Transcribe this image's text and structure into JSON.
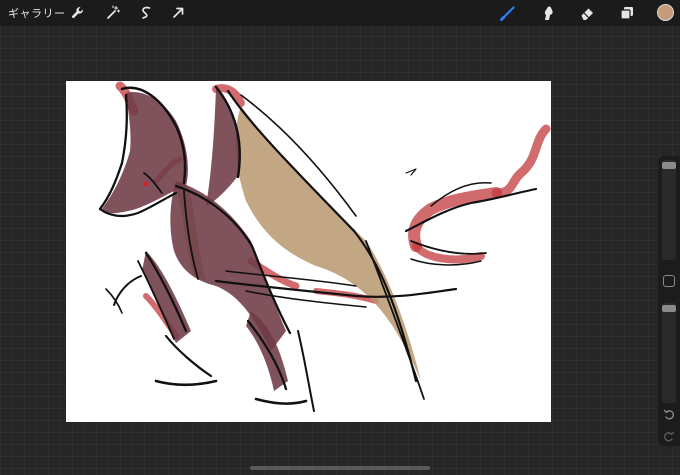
{
  "toolbar": {
    "gallery_label": "ギャラリー",
    "left_tools": [
      "wrench-icon",
      "magic-wand-icon",
      "selection-icon",
      "transform-arrow-icon"
    ],
    "right_tools": [
      "brush-icon",
      "smudge-icon",
      "eraser-icon",
      "layers-icon"
    ],
    "active_tool": "brush",
    "active_color": "#c69b7b",
    "accent": "#2f7cf6"
  },
  "sidebar": {
    "brush_size_level": 0.0,
    "opacity_level": 0.0,
    "controls": [
      "brush-size-slider",
      "modify-button",
      "opacity-slider",
      "undo-icon",
      "redo-icon"
    ]
  }
}
